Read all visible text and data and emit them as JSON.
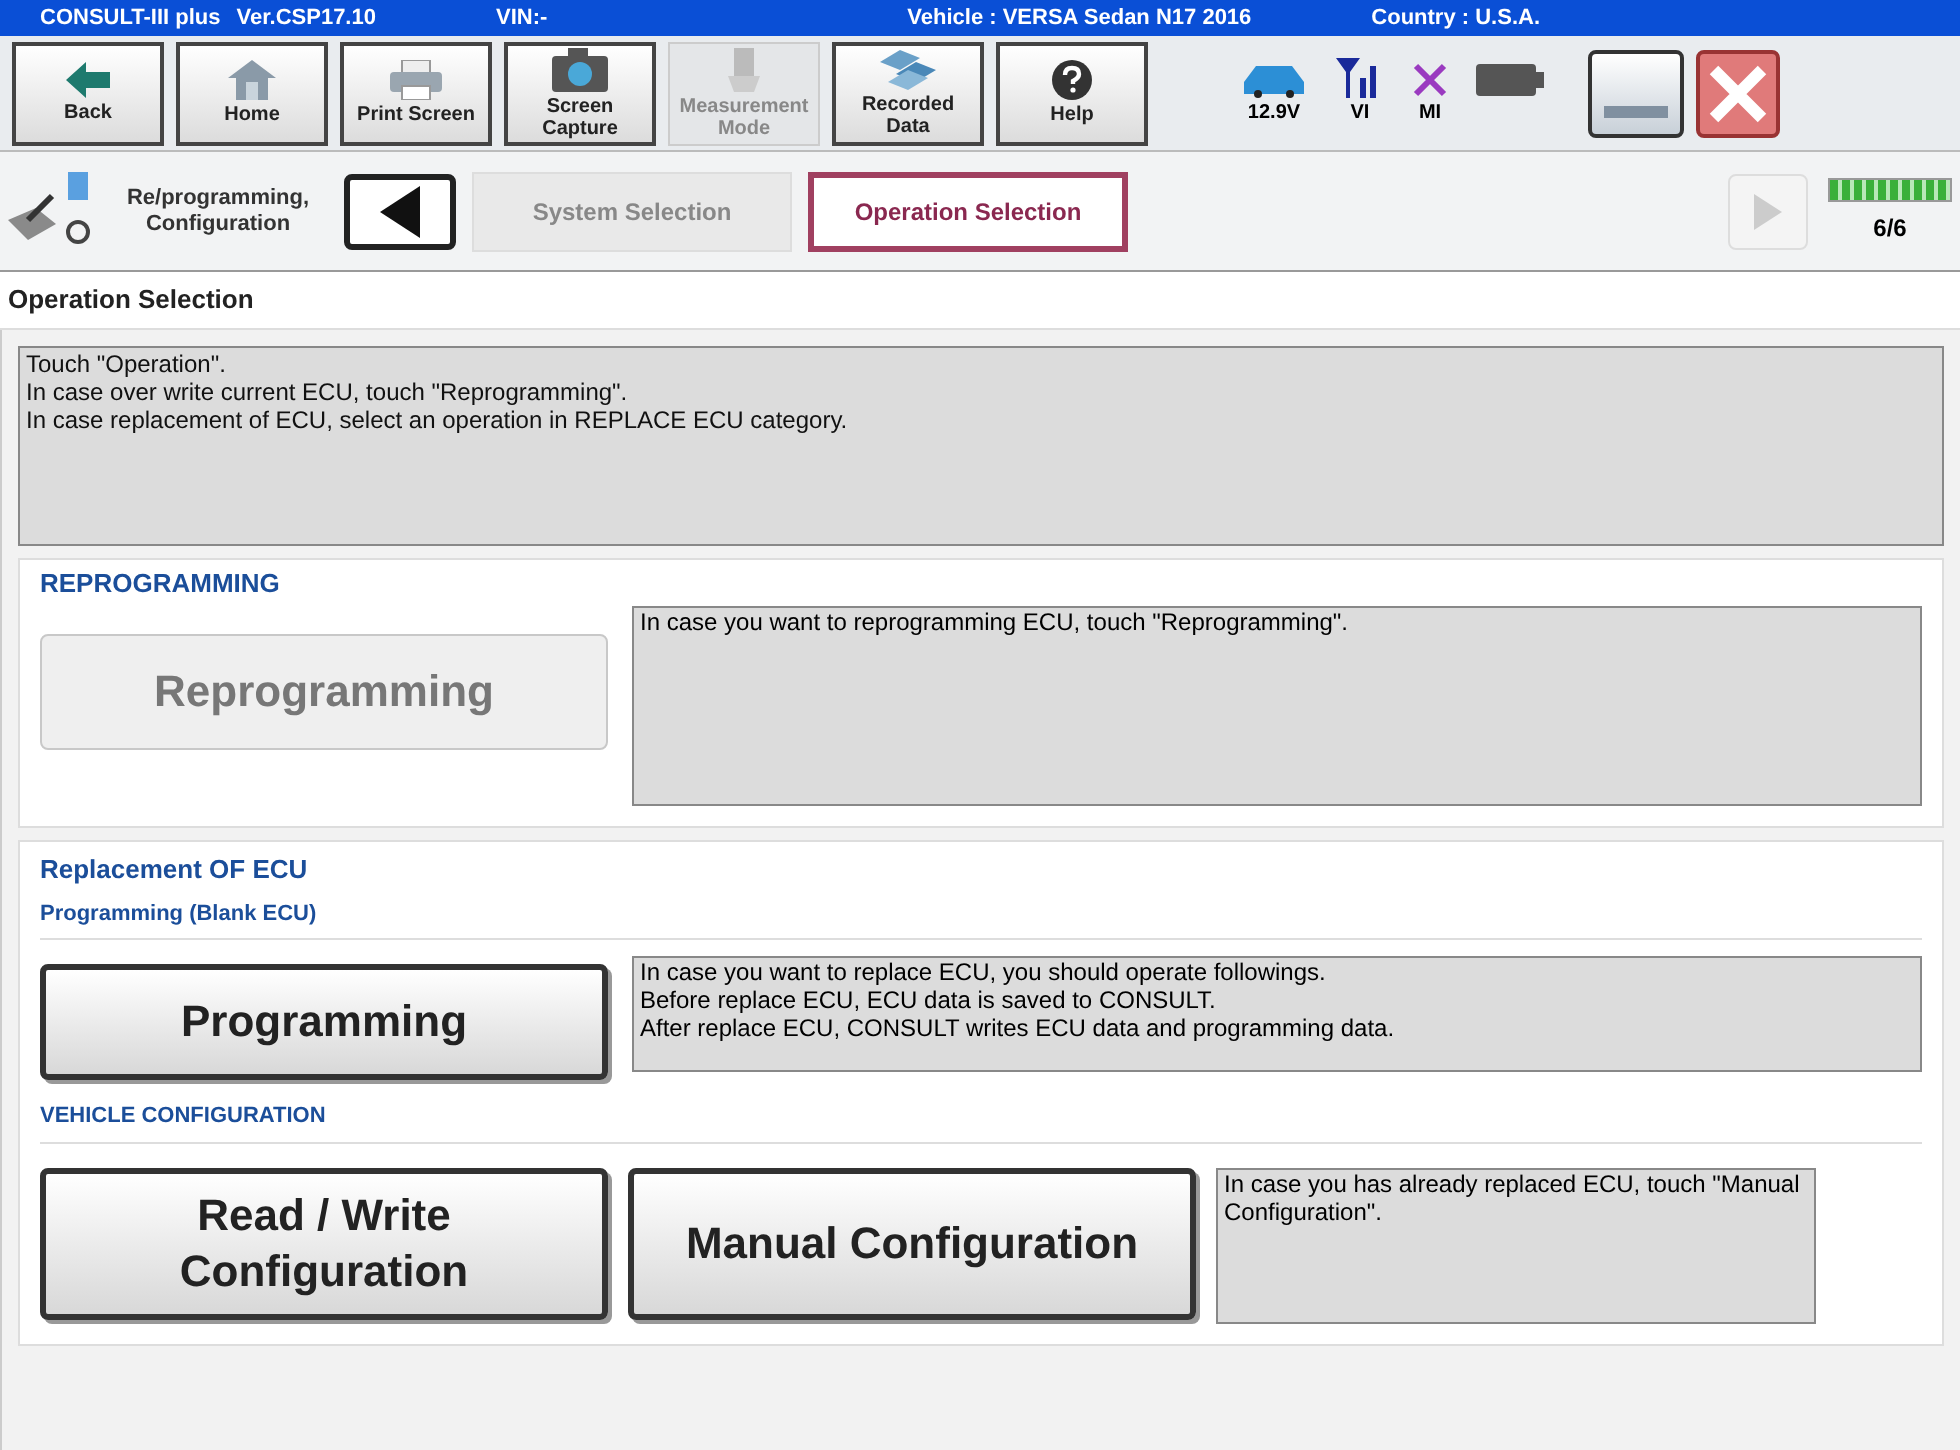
{
  "title_bar": {
    "app": "CONSULT-III plus",
    "version": "Ver.CSP17.10",
    "vin": "VIN:-",
    "vehicle": "Vehicle : VERSA Sedan N17 2016",
    "country": "Country : U.S.A."
  },
  "toolbar": [
    {
      "label": "Back",
      "kind": "back",
      "disabled": false
    },
    {
      "label": "Home",
      "kind": "home",
      "disabled": false
    },
    {
      "label": "Print Screen",
      "kind": "print",
      "disabled": false
    },
    {
      "label": "Screen Capture",
      "kind": "camera",
      "disabled": false
    },
    {
      "label": "Measurement Mode",
      "kind": "measure",
      "disabled": true
    },
    {
      "label": "Recorded Data",
      "kind": "data",
      "disabled": false
    },
    {
      "label": "Help",
      "kind": "help",
      "disabled": false
    }
  ],
  "status": {
    "voltage": "12.9V",
    "vi": "VI",
    "mi": "MI"
  },
  "breadcrumb": {
    "module": "Re/programming, Configuration",
    "steps": [
      {
        "label": "System Selection",
        "selected": false
      },
      {
        "label": "Operation Selection",
        "selected": true
      }
    ],
    "progress": {
      "level": 1,
      "label": "6/6"
    }
  },
  "page_title": "Operation Selection",
  "instructions": [
    "Touch  \"Operation\".",
    "In case over write current ECU, touch \"Reprogramming\".",
    "In case replacement of ECU, select an operation in REPLACE ECU category."
  ],
  "reprogramming": {
    "heading": "REPROGRAMMING",
    "button": {
      "label": "Reprogramming",
      "disabled": true
    },
    "description": "In case you want to reprogramming ECU, touch \"Reprogramming\"."
  },
  "replacement": {
    "heading": "Replacement OF ECU",
    "programming": {
      "heading": "Programming (Blank ECU)",
      "button": {
        "label": "Programming",
        "disabled": false
      },
      "description": [
        "In case you want to replace ECU, you should operate followings.",
        "Before replace ECU, ECU data is saved to CONSULT.",
        "After replace ECU, CONSULT writes ECU data and programming data."
      ]
    },
    "vehicle_configuration": {
      "heading": "VEHICLE CONFIGURATION",
      "buttons": [
        {
          "label": "Read / Write Configuration",
          "disabled": false
        },
        {
          "label": "Manual Configuration",
          "disabled": false
        }
      ],
      "description": "In case you has already replaced ECU, touch \"Manual Configuration\"."
    }
  }
}
